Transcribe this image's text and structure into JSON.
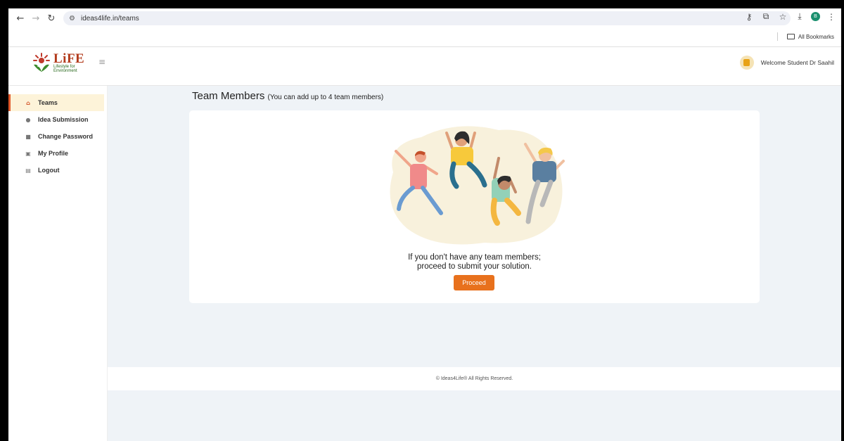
{
  "browser": {
    "url": "ideas4life.in/teams",
    "bookmarks_label": "All Bookmarks",
    "profile_initial": "B"
  },
  "header": {
    "logo_title": "LiFE",
    "logo_subtitle_1": "Lifestyle for",
    "logo_subtitle_2": "Environment",
    "welcome_text": "Welcome Student Dr Saahil"
  },
  "sidebar": {
    "items": [
      {
        "label": "Teams",
        "icon": "team-icon"
      },
      {
        "label": "Idea Submission",
        "icon": "bulb-icon"
      },
      {
        "label": "Change Password",
        "icon": "lock-icon"
      },
      {
        "label": "My Profile",
        "icon": "profile-icon"
      },
      {
        "label": "Logout",
        "icon": "logout-icon"
      }
    ]
  },
  "main": {
    "title": "Team Members",
    "title_note": "(You can add up to 4 team members)",
    "message_line1": "If you don't have any team members;",
    "message_line2": "proceed to submit your solution.",
    "proceed_label": "Proceed"
  },
  "footer": {
    "text": "© Ideas4Life® All Rights Reserved."
  },
  "colors": {
    "accent": "#e8711d",
    "active_bg": "#fdf3d9",
    "page_bg": "#eff3f7"
  }
}
